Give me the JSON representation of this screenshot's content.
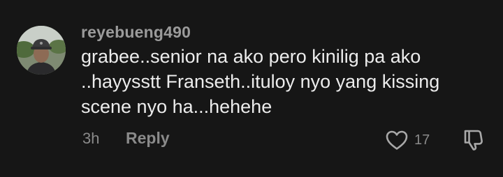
{
  "comment": {
    "username": "reyebueng490",
    "text": "grabee..senior na ako pero kinilig pa ako ..hayysstt Franseth..ituloy nyo yang kissing scene nyo ha...hehehe",
    "time": "3h",
    "reply_label": "Reply",
    "like_count": "17",
    "icons": {
      "like": "heart-outline-icon",
      "dislike": "thumbs-down-icon"
    }
  },
  "colors": {
    "background": "#161616",
    "username": "#9b9b9b",
    "text": "#ececec",
    "meta": "#8a8a8a"
  }
}
